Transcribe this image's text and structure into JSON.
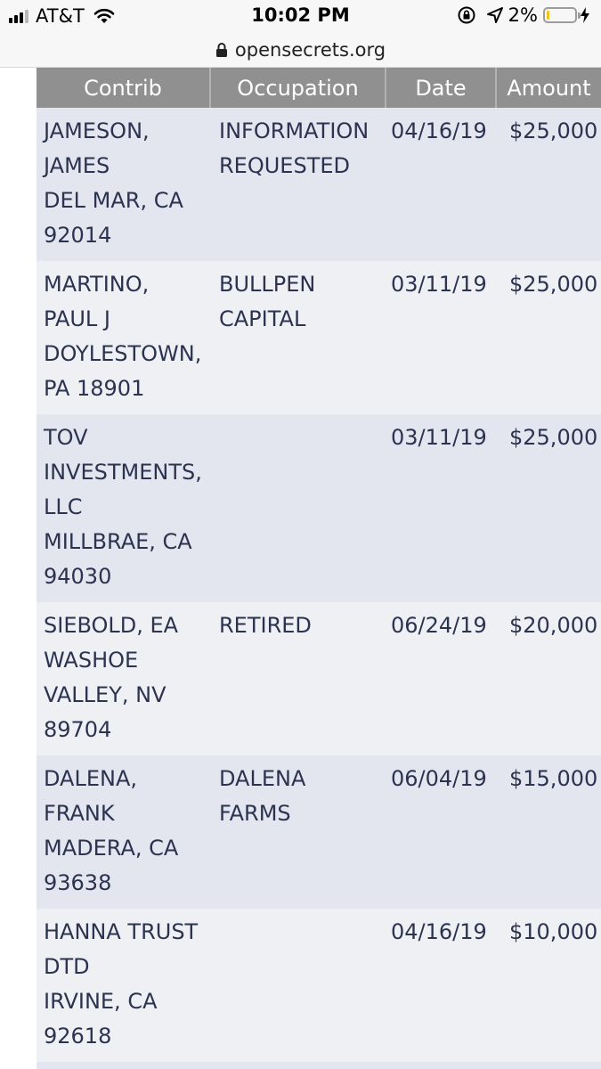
{
  "status_bar": {
    "carrier": "AT&T",
    "time": "10:02 PM",
    "battery_percent": "2%",
    "signal_icon": "signal-bars-icon",
    "wifi_icon": "wifi-icon",
    "rotation_lock_icon": "rotation-lock-icon",
    "location_icon": "location-arrow-icon",
    "charging_icon": "charging-bolt-icon",
    "battery_level": 0.02,
    "battery_color": "#f0c419"
  },
  "url_bar": {
    "url": "opensecrets.org",
    "lock_icon": "lock-icon"
  },
  "table": {
    "header_color": "#909090",
    "columns": [
      "Contrib",
      "Occupation",
      "Date",
      "Amount"
    ],
    "rows": [
      {
        "contrib": [
          "JAMESON,",
          "JAMES",
          "DEL MAR, CA",
          "92014"
        ],
        "occupation": [
          "INFORMATION",
          "REQUESTED"
        ],
        "date": "04/16/19",
        "amount": "$25,000"
      },
      {
        "contrib": [
          "MARTINO,",
          "PAUL J",
          "DOYLESTOWN,",
          "PA 18901"
        ],
        "occupation": [
          "BULLPEN",
          "CAPITAL"
        ],
        "date": "03/11/19",
        "amount": "$25,000"
      },
      {
        "contrib": [
          "TOV",
          "INVESTMENTS,",
          "LLC",
          "MILLBRAE, CA",
          "94030"
        ],
        "occupation": [],
        "date": "03/11/19",
        "amount": "$25,000"
      },
      {
        "contrib": [
          "SIEBOLD, EA",
          "WASHOE",
          "VALLEY, NV",
          "89704"
        ],
        "occupation": [
          "RETIRED"
        ],
        "date": "06/24/19",
        "amount": "$20,000"
      },
      {
        "contrib": [
          "DALENA,",
          "FRANK",
          "MADERA, CA",
          "93638"
        ],
        "occupation": [
          "DALENA",
          "FARMS"
        ],
        "date": "06/04/19",
        "amount": "$15,000"
      },
      {
        "contrib": [
          "HANNA TRUST",
          "DTD",
          "IRVINE, CA",
          "92618"
        ],
        "occupation": [],
        "date": "04/16/19",
        "amount": "$10,000"
      }
    ]
  }
}
